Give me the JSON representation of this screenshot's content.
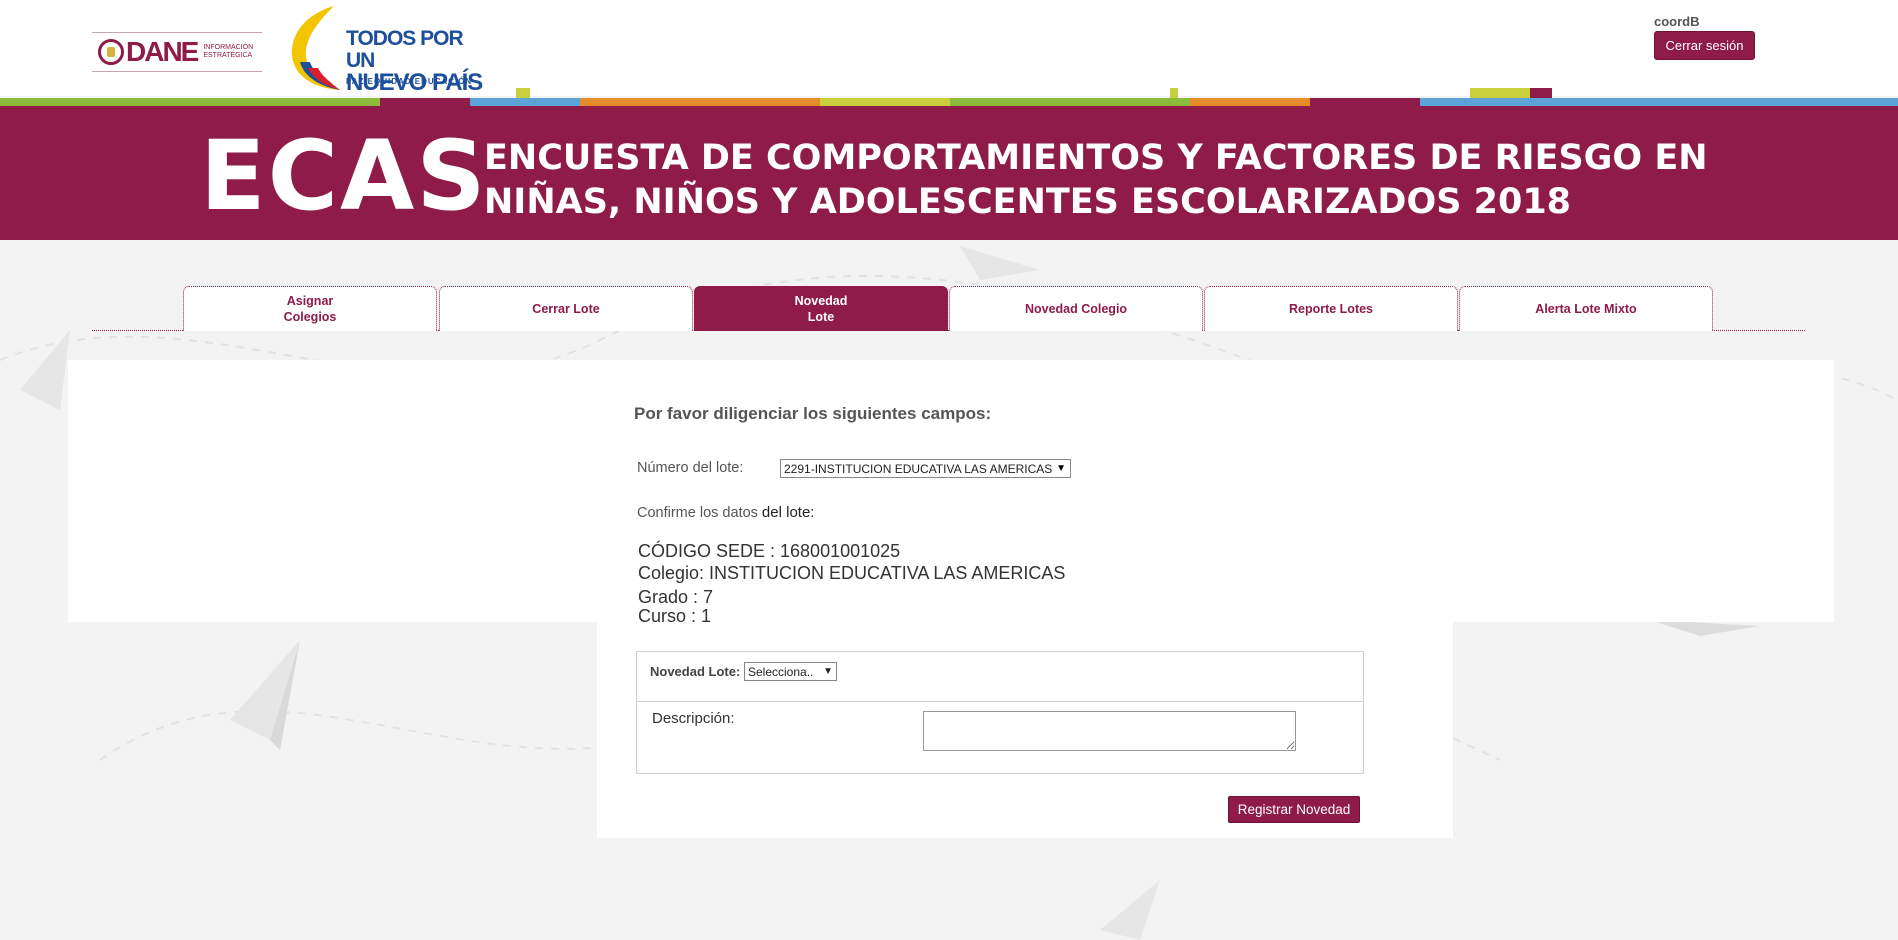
{
  "header": {
    "dane_logo": {
      "word": "DANE",
      "subtitle_line1": "INFORMACIÓN",
      "subtitle_line2": "ESTRATÉGICA"
    },
    "gov_logo": {
      "line1": "TODOS POR UN",
      "line2": "NUEVO PAÍS",
      "slogan": "PAZ   EQUIDAD   EDUCACIÓN"
    },
    "user": "coordB",
    "logout_label": "Cerrar sesión"
  },
  "banner": {
    "acronym": "ECAS",
    "title_line1": "ENCUESTA DE COMPORTAMIENTOS Y FACTORES DE RIESGO EN",
    "title_line2": "NIÑAS, NIÑOS Y ADOLESCENTES ESCOLARIZADOS 2018",
    "background_color": "#8e1b48"
  },
  "tabs": [
    {
      "label": "Asignar Colegios",
      "active": false
    },
    {
      "label": "Cerrar Lote",
      "active": false
    },
    {
      "label": "Novedad Lote",
      "active": true
    },
    {
      "label": "Novedad Colegio",
      "active": false
    },
    {
      "label": "Reporte Lotes",
      "active": false
    },
    {
      "label": "Alerta Lote Mixto",
      "active": false
    }
  ],
  "form": {
    "heading": "Por favor diligenciar los siguientes campos:",
    "lote_label": "Número del lote:",
    "lote_selected": "2291-INSTITUCION EDUCATIVA LAS AMERICAS",
    "confirm_prefix": "Confirme los datos",
    "confirm_suffix": "del lote:",
    "info": {
      "codigo": "CÓDIGO SEDE : 168001001025",
      "colegio": "Colegio: INSTITUCION EDUCATIVA LAS AMERICAS",
      "grado": "Grado : 7",
      "curso": "Curso : 1"
    },
    "novedad_label": "Novedad Lote:",
    "novedad_selected": "Selecciona..",
    "descripcion_label": "Descripción:",
    "descripcion_value": "",
    "submit_label": "Registrar Novedad"
  },
  "icons": {
    "dropdown_arrow": "▼"
  }
}
